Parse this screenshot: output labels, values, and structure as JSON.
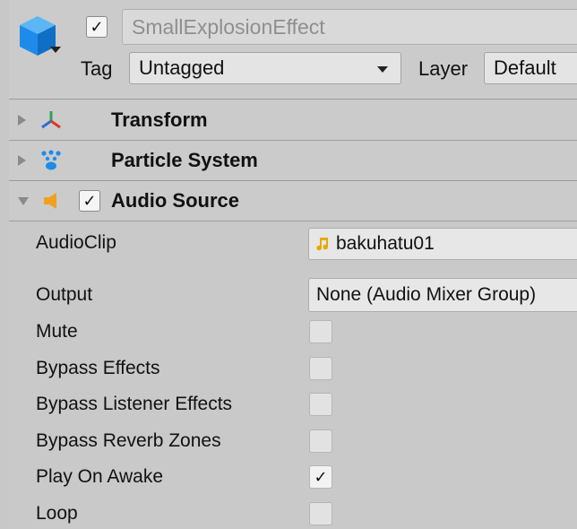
{
  "gameobject": {
    "name": "SmallExplosionEffect",
    "active_check": "✓",
    "tag_label": "Tag",
    "tag_value": "Untagged",
    "layer_label": "Layer",
    "layer_value": "Default"
  },
  "components": [
    {
      "title": "Transform",
      "icon": "transform-icon"
    },
    {
      "title": "Particle System",
      "icon": "particle-system-icon"
    },
    {
      "title": "Audio Source",
      "icon": "audio-source-icon",
      "enabled_check": "✓"
    }
  ],
  "audio_source": {
    "audioclip_label": "AudioClip",
    "audioclip_value": "bakuhatu01",
    "output_label": "Output",
    "output_value": "None (Audio Mixer Group)",
    "mute_label": "Mute",
    "bypass_effects_label": "Bypass Effects",
    "bypass_listener_label": "Bypass Listener Effects",
    "bypass_reverb_label": "Bypass Reverb Zones",
    "play_on_awake_label": "Play On Awake",
    "play_on_awake_check": "✓",
    "loop_label": "Loop"
  },
  "colors": {
    "unity_cube_blue": "#1d8ce8",
    "audio_icon_orange": "#f0a020",
    "clip_icon_yellow": "#e8a800"
  }
}
